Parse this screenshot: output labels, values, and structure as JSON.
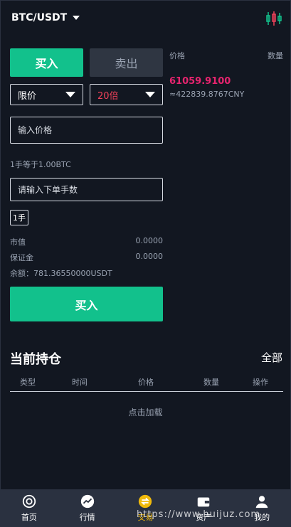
{
  "header": {
    "pair": "BTC/USDT"
  },
  "trade": {
    "buy_tab": "买入",
    "sell_tab": "卖出",
    "order_type": "限价",
    "leverage": "20倍",
    "price_placeholder": "输入价格",
    "lot_hint": "1手等于1.00BTC",
    "qty_placeholder": "请输入下单手数",
    "lot_chip": "1手",
    "market_value_label": "市值",
    "market_value": "0.0000",
    "margin_label": "保证金",
    "margin_value": "0.0000",
    "balance_text": "余额：781.36550000USDT",
    "buy_button": "买入"
  },
  "orderbook": {
    "price_header": "价格",
    "qty_header": "数量",
    "last_price": "61059.9100",
    "last_price_cny": "≈422839.8767CNY"
  },
  "positions": {
    "title": "当前持仓",
    "all_link": "全部",
    "columns": [
      "类型",
      "时间",
      "价格",
      "数量",
      "操作"
    ],
    "load_more": "点击加载"
  },
  "nav": {
    "items": [
      {
        "label": "首页",
        "icon": "home-icon"
      },
      {
        "label": "行情",
        "icon": "trend-icon"
      },
      {
        "label": "交易",
        "icon": "trade-icon"
      },
      {
        "label": "资产",
        "icon": "wallet-icon"
      },
      {
        "label": "我的",
        "icon": "user-icon"
      }
    ]
  },
  "watermark": "https://www.huijuz.com",
  "colors": {
    "background": "#121721",
    "accent_green": "#12c18c",
    "price_pink": "#e6246e",
    "leverage_red": "#f0425a",
    "nav_bg": "#2a3140",
    "active_nav": "#f0b90b"
  }
}
